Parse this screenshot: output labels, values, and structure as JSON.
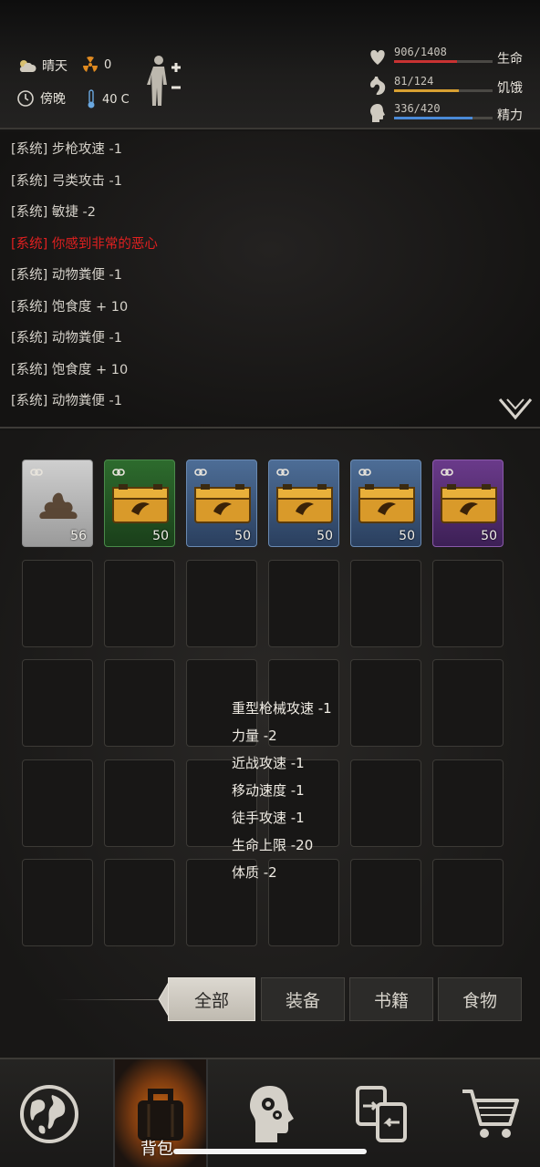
{
  "status": {
    "weather": "晴天",
    "radiation": "0",
    "time_of_day": "傍晚",
    "temperature": "40 C",
    "vitals": [
      {
        "label": "生命",
        "value": "906/1408",
        "fraction": 0.643,
        "color": "#c83232",
        "icon": "heart-icon"
      },
      {
        "label": "饥饿",
        "value": "81/124",
        "fraction": 0.653,
        "color": "#d8a032",
        "icon": "stomach-icon"
      },
      {
        "label": "精力",
        "value": "336/420",
        "fraction": 0.8,
        "color": "#4a8ad8",
        "icon": "head-icon"
      }
    ]
  },
  "log": [
    {
      "text": "[系统] 步枪攻速 -1",
      "alert": false
    },
    {
      "text": "[系统] 弓类攻击 -1",
      "alert": false
    },
    {
      "text": "[系统] 敏捷 -2",
      "alert": false
    },
    {
      "text": "[系统] 你感到非常的恶心",
      "alert": true
    },
    {
      "text": "[系统] 动物粪便 -1",
      "alert": false
    },
    {
      "text": "[系统] 饱食度 + 10",
      "alert": false
    },
    {
      "text": "[系统] 动物粪便 -1",
      "alert": false
    },
    {
      "text": "[系统] 饱食度 + 10",
      "alert": false
    },
    {
      "text": "[系统] 动物粪便 -1",
      "alert": false
    }
  ],
  "inventory": [
    {
      "item": "dung-item",
      "count": "56",
      "rarity": "grey"
    },
    {
      "item": "supply-crate-item",
      "count": "50",
      "rarity": "green"
    },
    {
      "item": "supply-crate-item",
      "count": "50",
      "rarity": "blue"
    },
    {
      "item": "supply-crate-item",
      "count": "50",
      "rarity": "blue"
    },
    {
      "item": "supply-crate-item",
      "count": "50",
      "rarity": "blue"
    },
    {
      "item": "supply-crate-item",
      "count": "50",
      "rarity": "purple"
    }
  ],
  "tooltip": [
    "重型枪械攻速 -1",
    "力量 -2",
    "近战攻速 -1",
    "移动速度 -1",
    "徒手攻速 -1",
    "生命上限 -20",
    "体质 -2"
  ],
  "tabs": [
    "全部",
    "装备",
    "书籍",
    "食物"
  ],
  "active_tab": 0,
  "nav": {
    "items": [
      "world-map-icon",
      "backpack-icon",
      "skills-head-icon",
      "exchange-icon",
      "cart-icon"
    ],
    "active": 1,
    "active_label": "背包"
  }
}
